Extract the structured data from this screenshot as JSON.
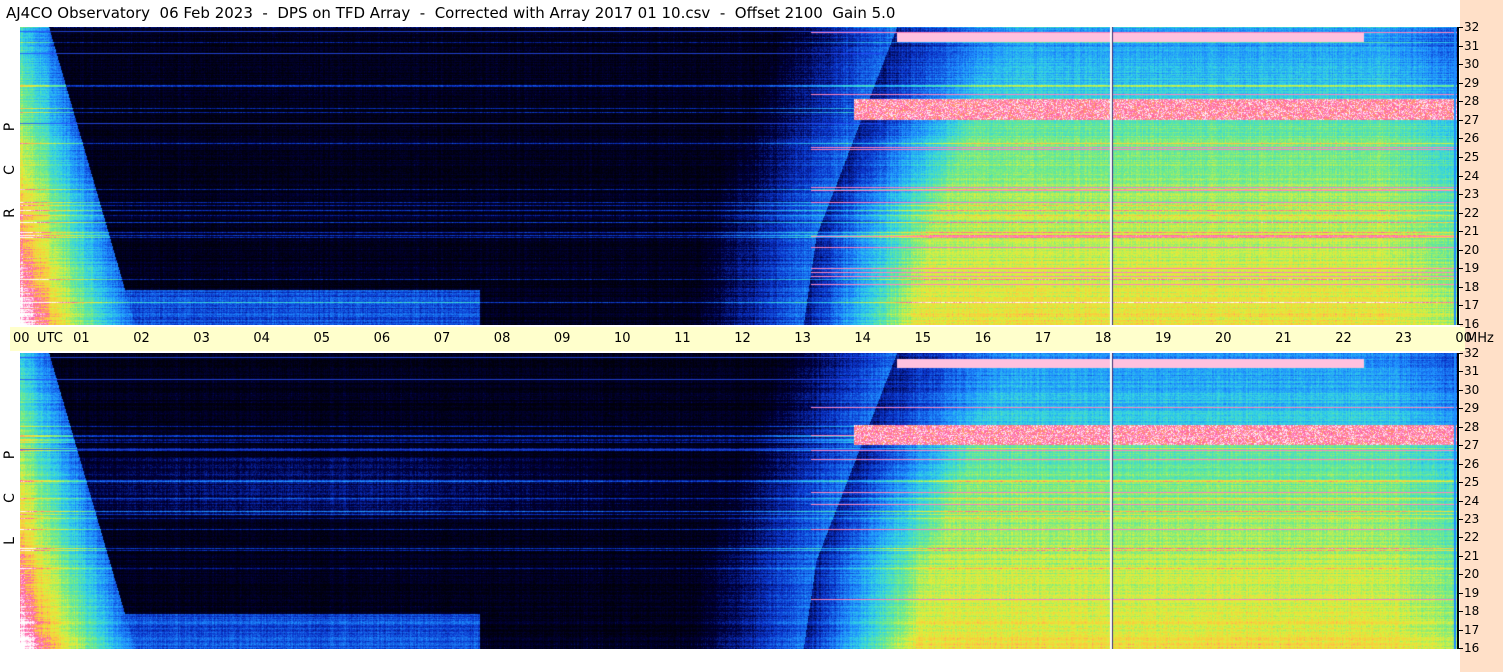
{
  "title": "AJ4CO Observatory  06 Feb 2023  -  DPS on TFD Array  -  Corrected with Array 2017 01 10.csv  -  Offset 2100  Gain 5.0",
  "panels": [
    {
      "id": "rcp",
      "label_letters": [
        "R",
        "C",
        "P"
      ]
    },
    {
      "id": "lcp",
      "label_letters": [
        "L",
        "C",
        "P"
      ]
    }
  ],
  "time_axis": {
    "utc_label": "UTC",
    "ticks": [
      "00",
      "01",
      "02",
      "03",
      "04",
      "05",
      "06",
      "07",
      "08",
      "09",
      "10",
      "11",
      "12",
      "13",
      "14",
      "15",
      "16",
      "17",
      "18",
      "19",
      "20",
      "21",
      "22",
      "23",
      "00"
    ],
    "unit_label": "MHz"
  },
  "freq_axis": {
    "labels": [
      "32",
      "31",
      "30",
      "29",
      "28",
      "27",
      "26",
      "25",
      "24",
      "23",
      "22",
      "21",
      "20",
      "19",
      "18",
      "17",
      "16"
    ]
  },
  "colors": {
    "background": "#ffffff",
    "time_strip": "#ffffcc",
    "freq_strip": "#ffe0c8",
    "spectrogram_low": "#000010",
    "spectrogram_mid": "#1e8cff",
    "spectrogram_high": "#ffe63c",
    "spectrogram_peak": "#ff3cc8"
  }
}
